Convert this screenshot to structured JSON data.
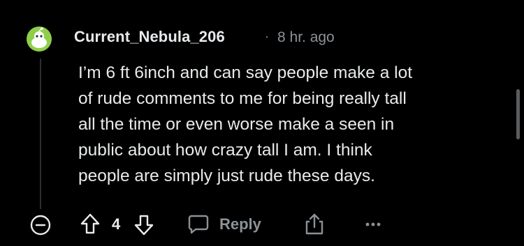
{
  "comment": {
    "username": "Current_Nebula_206",
    "separator": "·",
    "timestamp": "8 hr. ago",
    "body_lines": [
      "I’m 6 ft 6inch and can say people make a lot",
      "of rude comments to me for being really tall",
      "all the time or even worse make a seen in",
      "public about how crazy tall I am. I think",
      "people are simply just rude these days."
    ],
    "avatar": {
      "icon": "snoo-avatar-icon",
      "color": "#8fce4b"
    }
  },
  "actions": {
    "collapse_icon": "minus-circle-icon",
    "upvote_icon": "arrow-up-icon",
    "vote_count": "4",
    "downvote_icon": "arrow-down-icon",
    "reply_icon": "speech-bubble-icon",
    "reply_label": "Reply",
    "share_icon": "share-icon",
    "more_icon": "ellipsis-icon"
  },
  "colors": {
    "background": "#000000",
    "text_primary": "#e8eaec",
    "text_secondary": "#8b9297"
  }
}
